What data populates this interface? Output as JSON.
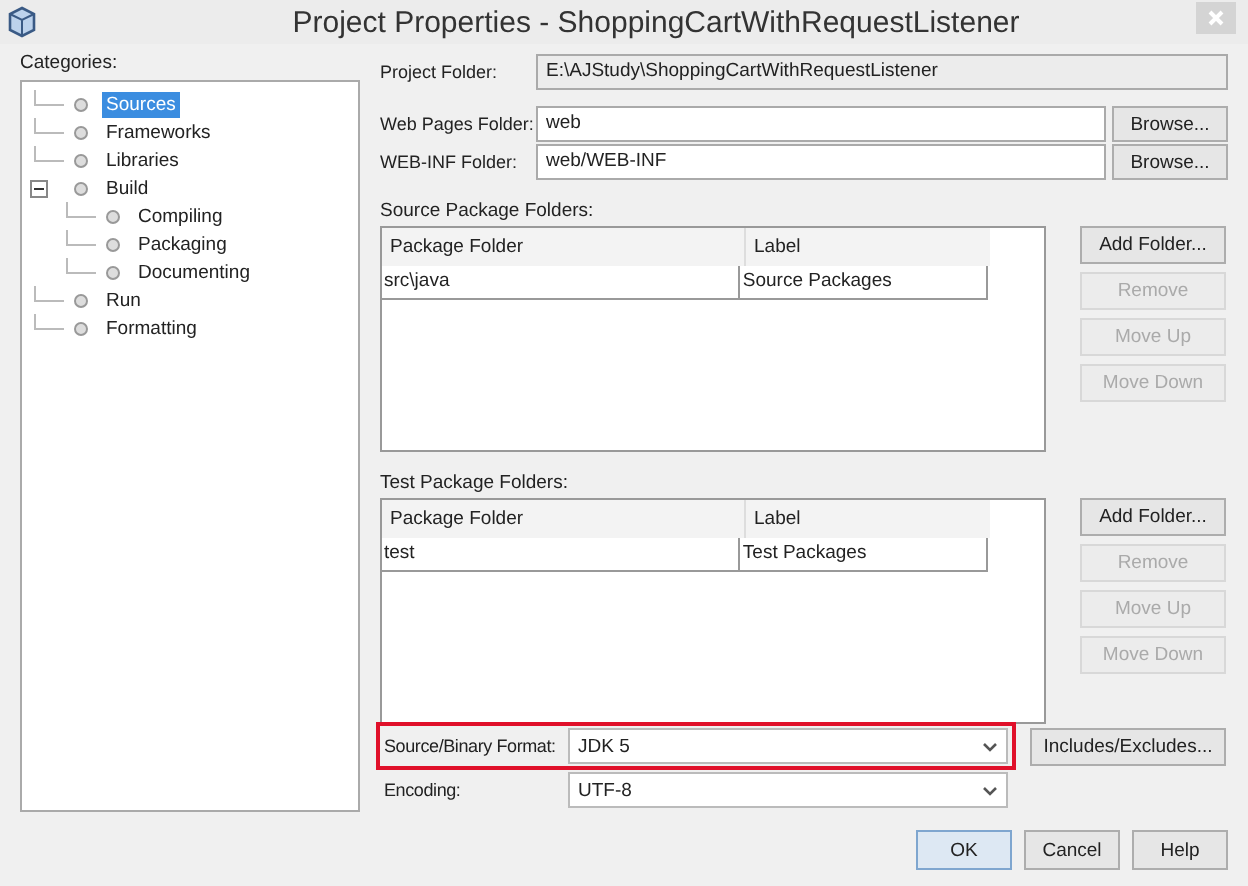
{
  "window": {
    "title": "Project Properties - ShoppingCartWithRequestListener"
  },
  "categories": {
    "label": "Categories:",
    "items": [
      {
        "label": "Sources",
        "selected": true
      },
      {
        "label": "Frameworks",
        "selected": false
      },
      {
        "label": "Libraries",
        "selected": false
      },
      {
        "label": "Build",
        "selected": false,
        "expanded": true,
        "children": [
          {
            "label": "Compiling",
            "selected": false
          },
          {
            "label": "Packaging",
            "selected": false
          },
          {
            "label": "Documenting",
            "selected": false
          }
        ]
      },
      {
        "label": "Run",
        "selected": false
      },
      {
        "label": "Formatting",
        "selected": false
      }
    ]
  },
  "folders": [
    {
      "label": "Project Folder:",
      "value": "E:\\AJStudy\\ShoppingCartWithRequestListener",
      "editable": false
    },
    {
      "label": "Web Pages Folder:",
      "value": "web",
      "editable": true,
      "button": "Browse..."
    },
    {
      "label": "WEB-INF Folder:",
      "value": "web/WEB-INF",
      "editable": true,
      "button": "Browse..."
    }
  ],
  "package_tables": [
    {
      "label": "Source Package Folders:",
      "columns": [
        "Package Folder",
        "Label"
      ],
      "rows": [
        [
          "src\\java",
          "Source Packages"
        ]
      ],
      "buttons": [
        {
          "label": "Add Folder...",
          "disabled": false
        },
        {
          "label": "Remove",
          "disabled": true
        },
        {
          "label": "Move Up",
          "disabled": true
        },
        {
          "label": "Move Down",
          "disabled": true
        }
      ]
    },
    {
      "label": "Test Package Folders:",
      "columns": [
        "Package Folder",
        "Label"
      ],
      "rows": [
        [
          "test",
          "Test Packages"
        ]
      ],
      "buttons": [
        {
          "label": "Add Folder...",
          "disabled": false
        },
        {
          "label": "Remove",
          "disabled": true
        },
        {
          "label": "Move Up",
          "disabled": true
        },
        {
          "label": "Move Down",
          "disabled": true
        }
      ]
    }
  ],
  "selects": [
    {
      "label": "Source/Binary Format:",
      "value": "JDK 5",
      "highlighted": true,
      "button": "Includes/Excludes..."
    },
    {
      "label": "Encoding:",
      "value": "UTF-8",
      "highlighted": false
    }
  ],
  "buttons": [
    "OK",
    "Cancel",
    "Help"
  ]
}
